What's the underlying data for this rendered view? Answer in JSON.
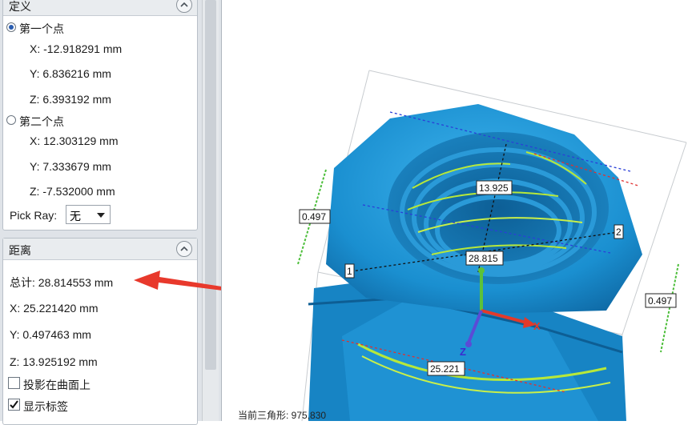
{
  "definition": {
    "title": "定义",
    "point1_label": "第一个点",
    "point1_x": "X: -12.918291 mm",
    "point1_y": "Y: 6.836216 mm",
    "point1_z": "Z: 6.393192 mm",
    "point2_label": "第二个点",
    "point2_x": "X: 12.303129 mm",
    "point2_y": "Y: 7.333679 mm",
    "point2_z": "Z: -7.532000 mm",
    "pick_ray_label": "Pick Ray:",
    "pick_ray_value": "无",
    "selected_point": 1
  },
  "distance": {
    "title": "距离",
    "total": "总计: 28.814553 mm",
    "x": "X: 25.221420 mm",
    "y": "Y: 0.497463 mm",
    "z": "Z: 13.925192 mm",
    "project_label": "投影在曲面上",
    "project_checked": false,
    "show_labels_label": "显示标签",
    "show_labels_checked": true
  },
  "viewport": {
    "labels": {
      "dim_top": "13.925",
      "dim_total": "28.815",
      "dim_bottom": "25.221",
      "dim_left": "0.497",
      "dim_right": "0.497",
      "point1": "1",
      "point2": "2"
    },
    "axis_x": "X",
    "axis_z": "Z",
    "status": "当前三角形: 975,830"
  },
  "colors": {
    "mesh": "#1a8fd0",
    "annotation_arrow": "#e8392c",
    "axis_x": "#e23a2a",
    "axis_y": "#5cc23a",
    "axis_z": "#5b4bd6"
  }
}
